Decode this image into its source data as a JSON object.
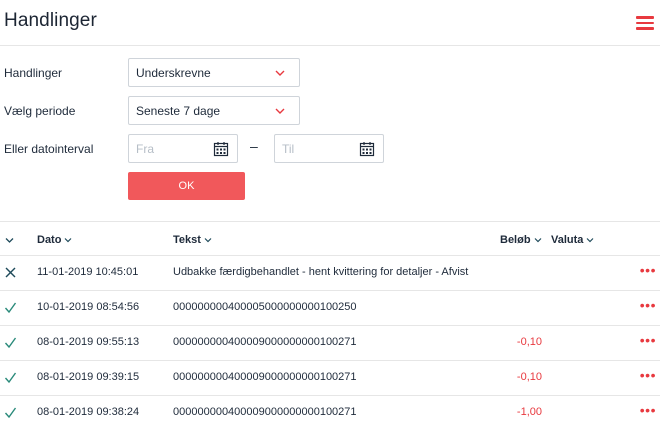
{
  "header": {
    "title": "Handlinger",
    "menu_icon": "hamburger-menu-icon"
  },
  "filters": {
    "action_label": "Handlinger",
    "action_value": "Underskrevne",
    "period_label": "Vælg periode",
    "period_value": "Seneste 7 dage",
    "interval_label": "Eller datointerval",
    "from_placeholder": "Fra",
    "to_placeholder": "Til",
    "dash": "–",
    "ok_label": "OK"
  },
  "table": {
    "columns": {
      "date": "Dato",
      "text": "Tekst",
      "amount": "Beløb",
      "currency": "Valuta"
    },
    "rows": [
      {
        "status": "rejected",
        "date": "11-01-2019 10:45:01",
        "text": "Udbakke færdigbehandlet - hent kvittering for detaljer - Afvist",
        "amount": "",
        "currency": ""
      },
      {
        "status": "ok",
        "date": "10-01-2019 08:54:56",
        "text": "000000000400005000000000100250",
        "amount": "",
        "currency": ""
      },
      {
        "status": "ok",
        "date": "08-01-2019 09:55:13",
        "text": "000000000400009000000000100271",
        "amount": "-0,10",
        "currency": ""
      },
      {
        "status": "ok",
        "date": "08-01-2019 09:39:15",
        "text": "000000000400009000000000100271",
        "amount": "-0,10",
        "currency": ""
      },
      {
        "status": "ok",
        "date": "08-01-2019 09:38:24",
        "text": "000000000400009000000000100271",
        "amount": "-1,00",
        "currency": ""
      }
    ],
    "more_label": "•••"
  },
  "colors": {
    "accent": "#e8393f",
    "button": "#f1585b",
    "text": "#1e2a3a",
    "status_check": "#2a8a7a",
    "status_x": "#1e4a5a"
  }
}
